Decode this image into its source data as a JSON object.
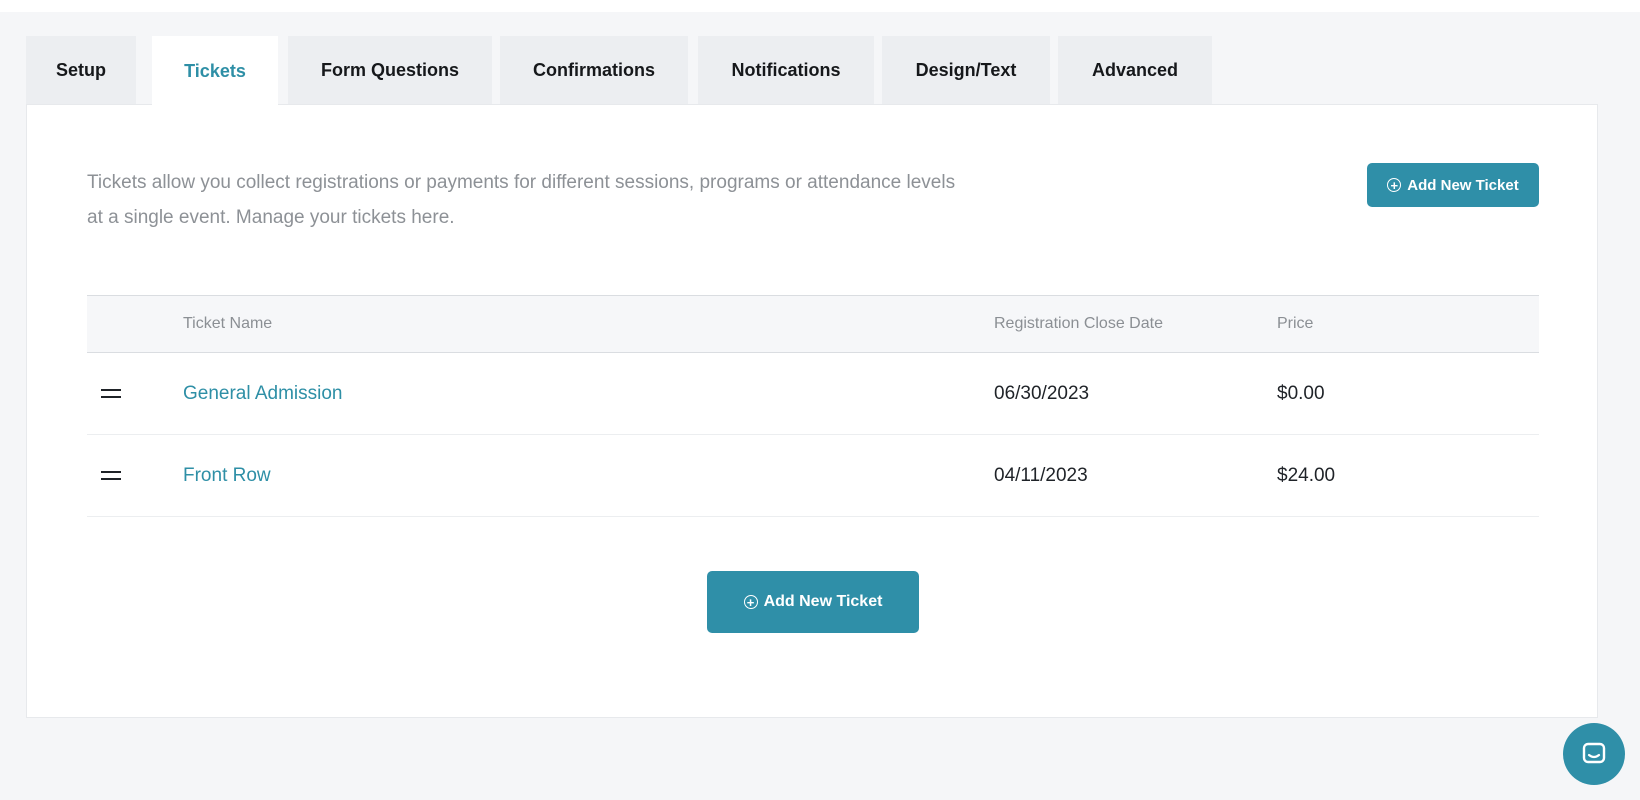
{
  "tabs": [
    {
      "label": "Setup",
      "active": false
    },
    {
      "label": "Tickets",
      "active": true
    },
    {
      "label": "Form Questions",
      "active": false
    },
    {
      "label": "Confirmations",
      "active": false
    },
    {
      "label": "Notifications",
      "active": false
    },
    {
      "label": "Design/Text",
      "active": false
    },
    {
      "label": "Advanced",
      "active": false
    }
  ],
  "intro": {
    "line1": "Tickets allow you collect registrations or payments for different sessions, programs or attendance levels",
    "line2": "at a single event. Manage your tickets here."
  },
  "buttons": {
    "add_new_ticket": "Add New Ticket"
  },
  "table": {
    "columns": [
      "Ticket Name",
      "Registration Close Date",
      "Price"
    ],
    "rows": [
      {
        "name": "General Admission",
        "close_date": "06/30/2023",
        "price": "$0.00"
      },
      {
        "name": "Front Row",
        "close_date": "04/11/2023",
        "price": "$24.00"
      }
    ]
  },
  "icons": {
    "drag": "drag-handle-icon",
    "add": "plus-circle-icon",
    "chat": "chat-bubble-icon"
  },
  "colors": {
    "accent": "#2f8fa8",
    "active_tab_text": "#2e8fa6",
    "muted_text": "#8d9196"
  }
}
